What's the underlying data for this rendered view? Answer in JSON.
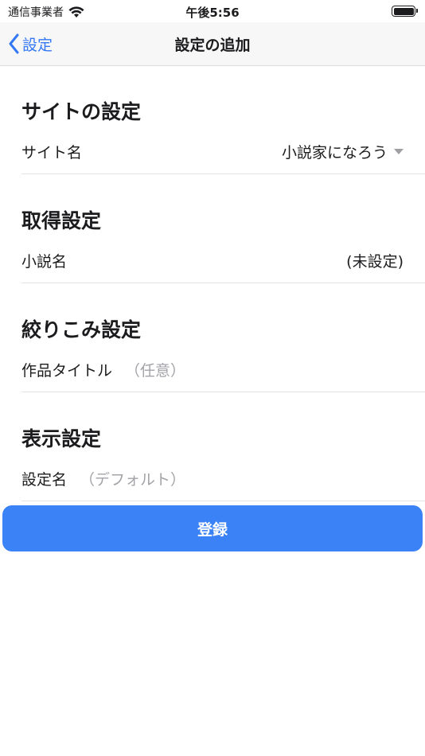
{
  "status_bar": {
    "carrier": "通信事業者",
    "time": "午後5:56",
    "battery_level": 1.0
  },
  "nav": {
    "back_label": "設定",
    "title": "設定の追加"
  },
  "sections": [
    {
      "title": "サイトの設定",
      "row": {
        "label": "サイト名",
        "value": "小説家になろう"
      }
    },
    {
      "title": "取得設定",
      "row": {
        "label": "小説名",
        "value": "(未設定)"
      }
    },
    {
      "title": "絞りこみ設定",
      "row": {
        "label": "作品タイトル",
        "placeholder": "（任意）"
      }
    },
    {
      "title": "表示設定",
      "row": {
        "label": "設定名",
        "placeholder": "（デフォルト）"
      }
    }
  ],
  "register_label": "登録",
  "colors": {
    "accent": "#3478f6",
    "button": "#3b82f6",
    "placeholder": "#a3a3a8"
  }
}
